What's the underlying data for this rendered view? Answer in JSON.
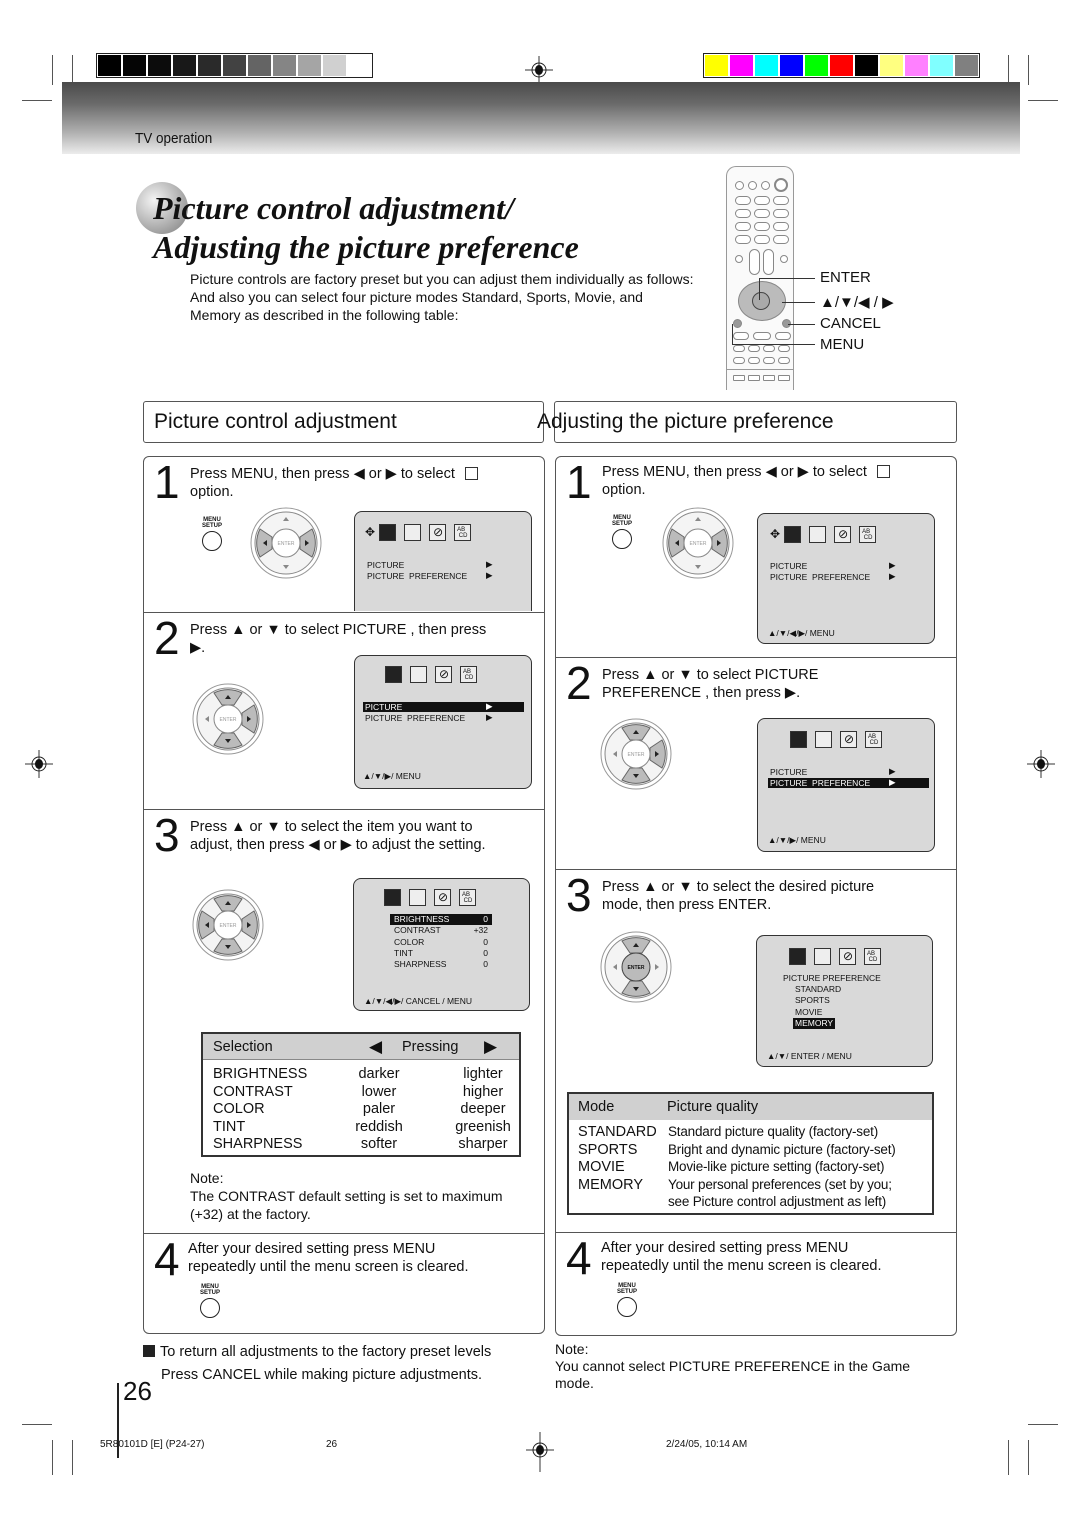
{
  "section_label": "TV operation",
  "colors": {
    "gray_bars": [
      "#000000",
      "#050505",
      "#0c0c0c",
      "#181818",
      "#2a2a2a",
      "#424242",
      "#646464",
      "#858585",
      "#a5a5a5",
      "#d0d0d0",
      "#ffffff"
    ],
    "color_bars": [
      "#ffff00",
      "#ff00ff",
      "#00ffff",
      "#0000ff",
      "#00ff00",
      "#ff0000",
      "#000000",
      "#ffff80",
      "#ff80ff",
      "#80ffff",
      "#808080"
    ]
  },
  "title": {
    "line1": "Picture control adjustment/",
    "line2": "Adjusting the picture preference"
  },
  "intro": {
    "line1": "Picture controls are factory preset but you can adjust them individually as follows:",
    "line2": "And also you can select four picture modes Standard, Sports, Movie, and",
    "line3": "Memory as described in the following table:"
  },
  "remote_labels": {
    "enter": "ENTER",
    "arrows": "▲/▼/◀ / ▶",
    "cancel": "CANCEL",
    "menu": "MENU"
  },
  "left": {
    "heading": "Picture control adjustment",
    "steps": [
      {
        "num": "1",
        "line1": "Press MENU, then press   ◀ or ▶ to select",
        "line2": "option."
      },
      {
        "num": "2",
        "line1": "Press ▲ or ▼ to select  PICTURE , then press",
        "line2": "▶."
      },
      {
        "num": "3",
        "line1": "Press ▲ or ▼ to select the item you want to",
        "line2": "adjust, then press   ◀ or ▶ to adjust the setting."
      },
      {
        "num": "4",
        "line1": "After your desired setting press MENU",
        "line2": "repeatedly until the menu screen is cleared."
      }
    ],
    "screen1": {
      "rows": [
        "PICTURE",
        "PICTURE  PREFERENCE"
      ]
    },
    "screen2": {
      "rows": [
        "PICTURE",
        "PICTURE  PREFERENCE"
      ],
      "hint": "▲/▼/▶/ MENU"
    },
    "screen3": {
      "items": [
        {
          "label": "BRIGHTNESS",
          "value": "0"
        },
        {
          "label": "CONTRAST",
          "value": "+32"
        },
        {
          "label": "COLOR",
          "value": "0"
        },
        {
          "label": "TINT",
          "value": "0"
        },
        {
          "label": "SHARPNESS",
          "value": "0"
        }
      ],
      "hint": "▲/▼/◀/▶/ CANCEL / MENU"
    },
    "selection_table": {
      "header_selection": "Selection",
      "header_pressing": "Pressing",
      "rows": [
        {
          "item": "BRIGHTNESS",
          "left": "darker",
          "right": "lighter"
        },
        {
          "item": "CONTRAST",
          "left": "lower",
          "right": "higher"
        },
        {
          "item": "COLOR",
          "left": "paler",
          "right": "deeper"
        },
        {
          "item": "TINT",
          "left": "reddish",
          "right": "greenish"
        },
        {
          "item": "SHARPNESS",
          "left": "softer",
          "right": "sharper"
        }
      ]
    },
    "note_label": "Note:",
    "note_line1": "The CONTRAST default setting is set to maximum",
    "note_line2": "(+32) at the factory.",
    "bottom_note_line1": "To return all adjustments to the factory preset levels",
    "bottom_note_line2": "Press CANCEL while making picture adjustments."
  },
  "right": {
    "heading": "Adjusting the picture preference",
    "steps": [
      {
        "num": "1",
        "line1": "Press MENU, then press   ◀ or ▶ to select",
        "line2": "option."
      },
      {
        "num": "2",
        "line1": "Press ▲ or ▼ to select  PICTURE",
        "line2": "PREFERENCE , then press   ▶."
      },
      {
        "num": "3",
        "line1": "Press ▲ or ▼ to select the desired picture",
        "line2": "mode, then press ENTER."
      },
      {
        "num": "4",
        "line1": "After your desired setting press MENU",
        "line2": "repeatedly until the menu screen is cleared."
      }
    ],
    "screen1": {
      "rows": [
        "PICTURE",
        "PICTURE  PREFERENCE"
      ],
      "hint": "▲/▼/◀/▶/ MENU"
    },
    "screen2": {
      "rows": [
        "PICTURE",
        "PICTURE  PREFERENCE"
      ],
      "hint": "▲/▼/▶/ MENU"
    },
    "screen3": {
      "title": "PICTURE PREFERENCE",
      "modes": [
        "STANDARD",
        "SPORTS",
        "MOVIE",
        "MEMORY"
      ],
      "selected": "MEMORY",
      "hint": "▲/▼/ ENTER / MENU"
    },
    "mode_table": {
      "header_mode": "Mode",
      "header_quality": "Picture quality",
      "rows": [
        {
          "mode": "STANDARD",
          "quality": "Standard picture quality (factory-set)"
        },
        {
          "mode": "SPORTS",
          "quality": "Bright and dynamic picture (factory-set)"
        },
        {
          "mode": "MOVIE",
          "quality": "Movie-like picture setting (factory-set)"
        },
        {
          "mode": "MEMORY",
          "quality": "Your personal preferences (set by you;"
        },
        {
          "mode": "",
          "quality": "see  Picture control adjustment  as left)"
        }
      ]
    },
    "note_label": "Note:",
    "note_line1": "You cannot select  PICTURE PREFERENCE  in the Game",
    "note_line2": "mode."
  },
  "button_labels": {
    "menu_top": "MENU",
    "menu_bottom": "SETUP",
    "enter": "ENTER"
  },
  "page_number": "26",
  "footer": {
    "doc_code": "5R80101D [E] (P24-27)",
    "page": "26",
    "date": "2/24/05, 10:14 AM"
  }
}
